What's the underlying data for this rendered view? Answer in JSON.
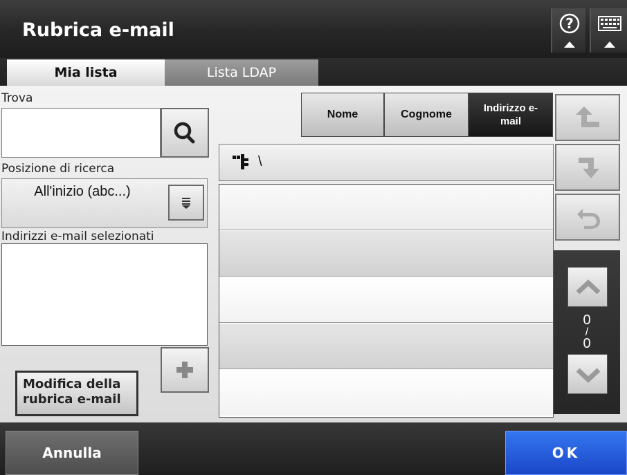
{
  "header": {
    "title": "Rubrica e-mail",
    "help_icon": "help-icon",
    "keyboard_icon": "keyboard-icon"
  },
  "tabs": [
    {
      "label": "Mia lista",
      "active": true
    },
    {
      "label": "Lista LDAP",
      "active": false
    }
  ],
  "left": {
    "find_label": "Trova",
    "find_value": "",
    "search_icon": "search-icon",
    "position_label": "Posizione di ricerca",
    "position_value": "All'inizio (abc...)",
    "position_icon": "dropdown-list-icon",
    "selected_label": "Indirizzi e-mail selezionati",
    "add_icon": "plus-icon",
    "edit_button": "Modifica della rubrica e-mail"
  },
  "sort": {
    "nome": "Nome",
    "cognome": "Cognome",
    "email": "Indirizzo e-mail",
    "selected": "email"
  },
  "path": {
    "icon": "folder-tree-icon",
    "text": "\\"
  },
  "list": {
    "rows": [
      "",
      "",
      "",
      "",
      ""
    ]
  },
  "side": {
    "up_icon": "go-up-icon",
    "down_icon": "go-into-icon",
    "back_icon": "undo-icon"
  },
  "pager": {
    "current": "0",
    "separator": "/",
    "total": "0"
  },
  "footer": {
    "cancel": "Annulla",
    "ok": "OK"
  },
  "colors": {
    "accent": "#2a5ee0",
    "dark": "#222222"
  }
}
